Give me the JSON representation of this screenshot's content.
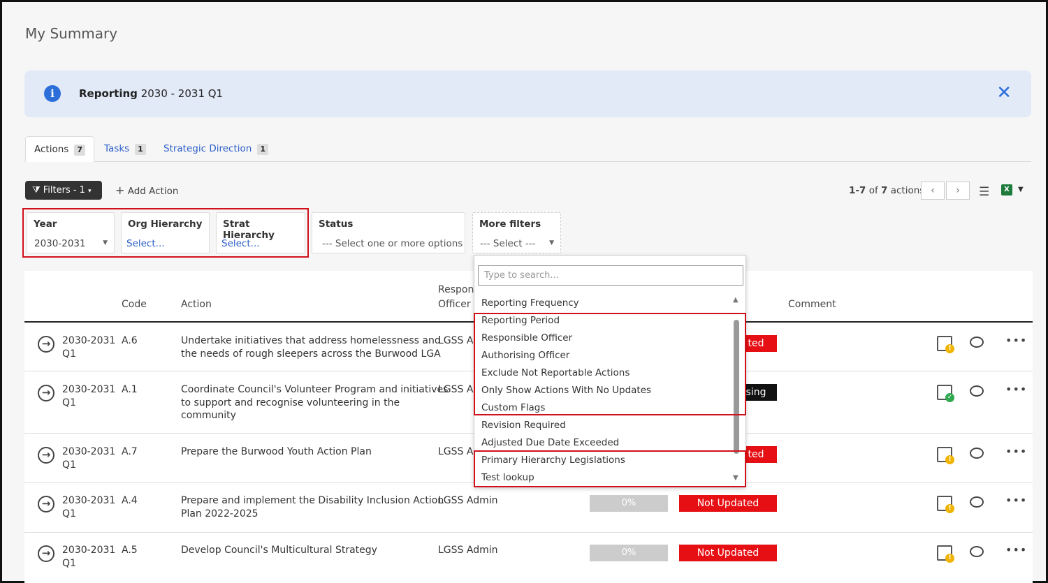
{
  "page": {
    "title": "My Summary"
  },
  "banner": {
    "label": "Reporting",
    "period": "2030 - 2031 Q1"
  },
  "tabs": [
    {
      "label": "Actions",
      "count": "7"
    },
    {
      "label": "Tasks",
      "count": "1"
    },
    {
      "label": "Strategic Direction",
      "count": "1"
    }
  ],
  "toolbar": {
    "filters_label": "Filters - 1",
    "add_action_label": "Add Action",
    "pager_range": "1-7",
    "pager_of": "of",
    "pager_total": "7",
    "pager_unit": "actions"
  },
  "filters": {
    "year": {
      "label": "Year",
      "value": "2030-2031"
    },
    "org": {
      "label": "Org Hierarchy",
      "value": "Select..."
    },
    "strat": {
      "label": "Strat Hierarchy",
      "value": "Select..."
    },
    "status": {
      "label": "Status",
      "placeholder": "--- Select one or more options ---"
    },
    "more": {
      "label": "More filters",
      "value": "--- Select ---"
    }
  },
  "dropdown": {
    "search_placeholder": "Type to search...",
    "items": [
      "Reporting Frequency",
      "Reporting Period",
      "Responsible Officer",
      "Authorising Officer",
      "Exclude Not Reportable Actions",
      "Only Show Actions With No Updates",
      "Custom Flags",
      "Revision Required",
      "Adjusted Due Date Exceeded",
      "Primary Hierarchy Legislations",
      "Test lookup"
    ]
  },
  "table": {
    "headers": {
      "code": "Code",
      "action": "Action",
      "responsible_1": "Respons",
      "responsible_2": "Officer",
      "comment": "Comment"
    },
    "rows": [
      {
        "period_1": "2030-2031",
        "period_2": "Q1",
        "code": "A.6",
        "action_1": "Undertake initiatives that address homelessness and",
        "action_2": "the needs of rough sleepers across the Burwood LGA",
        "action_3": "",
        "officer": "LGSS Ad",
        "pct": "",
        "status": "ted",
        "status_color": "#e60f14",
        "badge_color": "#f0b400",
        "badge": "!"
      },
      {
        "period_1": "2030-2031",
        "period_2": "Q1",
        "code": "A.1",
        "action_1": "Coordinate Council's Volunteer Program and initiatives",
        "action_2": "to support and recognise volunteering in the",
        "action_3": "community",
        "officer": "LGSS Ad",
        "pct": "",
        "status": "sing",
        "status_color": "#111111",
        "badge_color": "#2fa84f",
        "badge": "✓"
      },
      {
        "period_1": "2030-2031",
        "period_2": "Q1",
        "code": "A.7",
        "action_1": "Prepare the Burwood Youth Action Plan",
        "action_2": "",
        "action_3": "",
        "officer": "LGSS Ad",
        "pct": "",
        "status": "ted",
        "status_color": "#e60f14",
        "badge_color": "#f0b400",
        "badge": "!"
      },
      {
        "period_1": "2030-2031",
        "period_2": "Q1",
        "code": "A.4",
        "action_1": "Prepare and implement the Disability Inclusion Action",
        "action_2": "Plan 2022-2025",
        "action_3": "",
        "officer": "LGSS Admin",
        "pct": "0%",
        "status": "Not Updated",
        "status_color": "#e60f14",
        "badge_color": "#f0b400",
        "badge": "!"
      },
      {
        "period_1": "2030-2031",
        "period_2": "Q1",
        "code": "A.5",
        "action_1": "Develop Council's Multicultural Strategy",
        "action_2": "",
        "action_3": "",
        "officer": "LGSS Admin",
        "pct": "0%",
        "status": "Not Updated",
        "status_color": "#e60f14",
        "badge_color": "#f0b400",
        "badge": "!"
      }
    ]
  },
  "icons": {
    "info": "info-icon",
    "close": "close-icon",
    "filter": "filter-icon",
    "plus": "plus-icon",
    "prev": "chevron-left-icon",
    "next": "chevron-right-icon",
    "settings": "sliders-icon",
    "excel": "excel-icon",
    "view": "arrow-right-circle-icon",
    "edit": "edit-icon",
    "comment": "comment-icon",
    "more": "more-icon"
  }
}
